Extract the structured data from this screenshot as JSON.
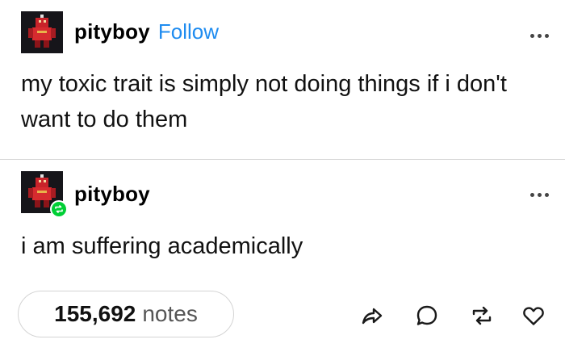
{
  "posts": [
    {
      "username": "pityboy",
      "follow_label": "Follow",
      "body": "my toxic trait is simply not doing things if i don't want to do them",
      "avatar_icon": "red-robot-avatar-icon"
    },
    {
      "username": "pityboy",
      "body": "i am suffering academically",
      "avatar_icon": "red-robot-avatar-icon",
      "badge_icon": "reblog-icon"
    }
  ],
  "footer": {
    "notes_count": "155,692",
    "notes_label": "notes",
    "actions": [
      "share-icon",
      "reply-icon",
      "reblog-icon",
      "like-icon"
    ]
  },
  "colors": {
    "follow": "#1f8cf0",
    "reblog_badge": "#00cf35",
    "divider": "#d9d9d9"
  }
}
